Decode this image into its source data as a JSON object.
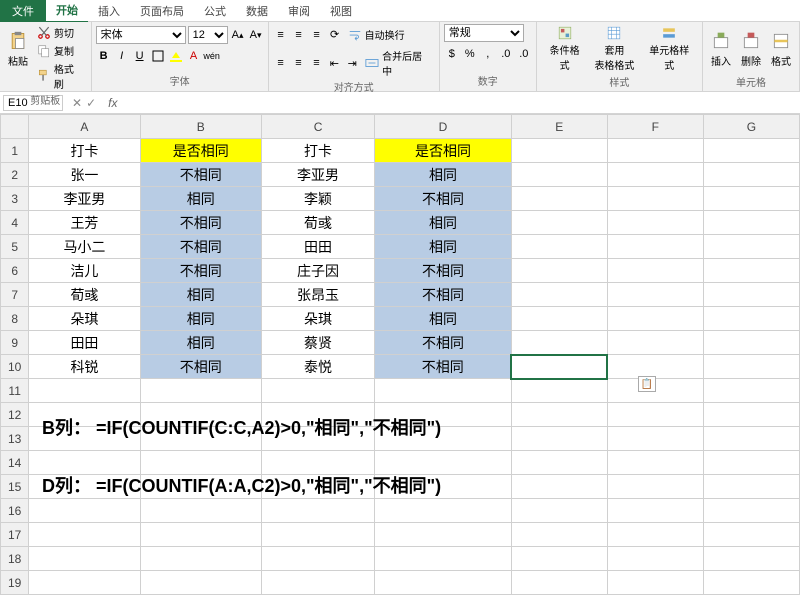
{
  "tabs": {
    "file": "文件",
    "home": "开始",
    "insert": "插入",
    "layout": "页面布局",
    "formulas": "公式",
    "data": "数据",
    "review": "审阅",
    "view": "视图"
  },
  "ribbon": {
    "clipboard": {
      "paste": "粘贴",
      "cut": "剪切",
      "copy": "复制",
      "painter": "格式刷",
      "label": "剪贴板"
    },
    "font": {
      "name": "宋体",
      "size": "12",
      "label": "字体",
      "bold": "B",
      "italic": "I",
      "underline": "U"
    },
    "align": {
      "wrap": "自动换行",
      "merge": "合并后居中",
      "label": "对齐方式"
    },
    "number": {
      "format": "常规",
      "label": "数字"
    },
    "styles": {
      "cond": "条件格式",
      "table": "套用\n表格格式",
      "cell": "单元格样式",
      "label": "样式"
    },
    "cells": {
      "insert": "插入",
      "delete": "删除",
      "format": "格式",
      "label": "单元格"
    }
  },
  "namebox": "E10",
  "fx_label": "fx",
  "columns": [
    "A",
    "B",
    "C",
    "D",
    "E",
    "F",
    "G"
  ],
  "rows": [
    "1",
    "2",
    "3",
    "4",
    "5",
    "6",
    "7",
    "8",
    "9",
    "10",
    "11",
    "12",
    "13",
    "14",
    "15",
    "16",
    "17",
    "18",
    "19"
  ],
  "cells": {
    "A1": "打卡",
    "B1": "是否相同",
    "C1": "打卡",
    "D1": "是否相同",
    "A2": "张一",
    "B2": "不相同",
    "C2": "李亚男",
    "D2": "相同",
    "A3": "李亚男",
    "B3": "相同",
    "C3": "李颖",
    "D3": "不相同",
    "A4": "王芳",
    "B4": "不相同",
    "C4": "荀彧",
    "D4": "相同",
    "A5": "马小二",
    "B5": "不相同",
    "C5": "田田",
    "D5": "相同",
    "A6": "洁儿",
    "B6": "不相同",
    "C6": "庄子因",
    "D6": "不相同",
    "A7": "荀彧",
    "B7": "相同",
    "C7": "张昂玉",
    "D7": "不相同",
    "A8": "朵琪",
    "B8": "相同",
    "C8": "朵琪",
    "D8": "相同",
    "A9": "田田",
    "B9": "相同",
    "C9": "蔡贤",
    "D9": "不相同",
    "A10": "科锐",
    "B10": "不相同",
    "C10": "泰悦",
    "D10": "不相同"
  },
  "annotations": {
    "line1": "B列：  =IF(COUNTIF(C:C,A2)>0,\"相同\",\"不相同\")",
    "line2": "D列：  =IF(COUNTIF(A:A,C2)>0,\"相同\",\"不相同\")"
  },
  "paste_opts_icon": "📋"
}
